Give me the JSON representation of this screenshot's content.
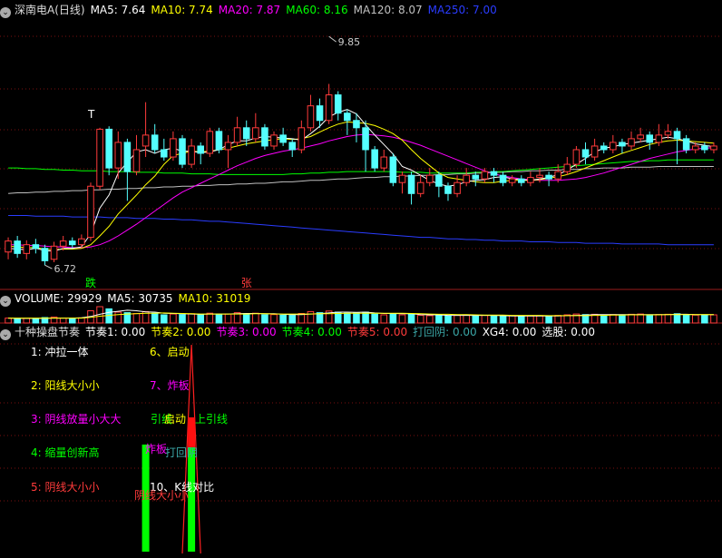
{
  "colors": {
    "up": "#ff3b3b",
    "down": "#54ffff",
    "ma5": "#ffffff",
    "ma10": "#ffff00",
    "ma20": "#ff00ff",
    "ma60": "#00ff00",
    "ma120": "#c0c0c0",
    "ma250": "#2a3cff",
    "grid": "#7a1010"
  },
  "price_panel": {
    "title": "深南电A(日线)",
    "ma": [
      {
        "label": "MA5: 7.64",
        "color": "#ffffff"
      },
      {
        "label": "MA10: 7.74",
        "color": "#ffff00"
      },
      {
        "label": "MA20: 7.87",
        "color": "#ff00ff"
      },
      {
        "label": "MA60: 8.16",
        "color": "#00ff00"
      },
      {
        "label": "MA120: 8.07",
        "color": "#c0c0c0"
      },
      {
        "label": "MA250: 7.00",
        "color": "#2a3cff"
      }
    ],
    "high_label": "9.85",
    "low_label": "6.72",
    "mark_t": "T",
    "mark_die": "跌",
    "mark_zhang": "张"
  },
  "volume_panel": {
    "labels": [
      {
        "label": "VOLUME: 29929",
        "color": "#ffffff"
      },
      {
        "label": "MA5: 30735",
        "color": "#ffffff"
      },
      {
        "label": "MA10: 31019",
        "color": "#ffff00"
      }
    ]
  },
  "indicator_panel": {
    "title": "十种操盘节奏",
    "labels": [
      {
        "label": "节奏1: 0.00",
        "color": "#ffffff"
      },
      {
        "label": "节奏2: 0.00",
        "color": "#ffff00"
      },
      {
        "label": "节奏3: 0.00",
        "color": "#ff00ff"
      },
      {
        "label": "节奏4: 0.00",
        "color": "#00ff00"
      },
      {
        "label": "节奏5: 0.00",
        "color": "#ff3b3b"
      },
      {
        "label": "打回阴: 0.00",
        "color": "#3aa6a6"
      },
      {
        "label": "XG4: 0.00",
        "color": "#ffffff"
      },
      {
        "label": "选股: 0.00",
        "color": "#ffffff"
      }
    ],
    "legend_left": [
      {
        "text": "1: 冲拉一体",
        "color": "#ffffff"
      },
      {
        "text": "2: 阳线大小小",
        "color": "#ffff00"
      },
      {
        "text": "3: 阴线放量小大大",
        "color": "#ff00ff"
      },
      {
        "text": "4: 缩量创新高",
        "color": "#00ff00"
      },
      {
        "text": "5: 阴线大小小",
        "color": "#ff3b3b"
      }
    ],
    "legend_right": [
      {
        "text": "6、启动",
        "color": "#ffff00"
      },
      {
        "text": "7、炸板",
        "color": "#ff00ff"
      },
      {
        "text": "上引线",
        "color": "#00ff00"
      },
      {
        "text": "打回阴",
        "color": "#3aa6a6"
      },
      {
        "text": "10、K线对比",
        "color": "#ffffff"
      }
    ],
    "overlay_texts": [
      {
        "text": "引线",
        "color": "#00ff00"
      },
      {
        "text": "启动",
        "color": "#ffff00"
      },
      {
        "text": "炸板",
        "color": "#ff00ff"
      },
      {
        "text": "阴线大小小",
        "color": "#ff3b3b"
      }
    ]
  },
  "chart_data": {
    "type": "candlestick",
    "ylim_price": [
      6.4,
      10.1
    ],
    "high": 9.85,
    "low": 6.72,
    "candles": [
      [
        6.9,
        7.05,
        6.8,
        7.1
      ],
      [
        7.05,
        6.88,
        6.82,
        7.12
      ],
      [
        6.88,
        7.0,
        6.8,
        7.06
      ],
      [
        7.0,
        6.95,
        6.88,
        7.08
      ],
      [
        6.95,
        6.78,
        6.72,
        7.0
      ],
      [
        6.8,
        6.98,
        6.76,
        7.04
      ],
      [
        6.98,
        7.05,
        6.92,
        7.12
      ],
      [
        7.05,
        7.0,
        6.95,
        7.1
      ],
      [
        7.0,
        7.08,
        6.96,
        7.14
      ],
      [
        7.1,
        7.8,
        7.05,
        7.85
      ],
      [
        7.8,
        8.58,
        7.75,
        8.6
      ],
      [
        8.58,
        8.05,
        7.95,
        8.62
      ],
      [
        8.05,
        8.4,
        7.9,
        8.55
      ],
      [
        8.4,
        8.0,
        7.6,
        8.45
      ],
      [
        8.0,
        8.3,
        7.95,
        8.5
      ],
      [
        8.35,
        8.5,
        8.2,
        8.95
      ],
      [
        8.5,
        8.3,
        8.25,
        8.65
      ],
      [
        8.3,
        8.2,
        8.15,
        8.45
      ],
      [
        8.2,
        8.45,
        8.15,
        8.55
      ],
      [
        8.45,
        8.1,
        8.05,
        8.5
      ],
      [
        8.1,
        8.35,
        8.05,
        8.45
      ],
      [
        8.35,
        8.25,
        8.1,
        8.4
      ],
      [
        8.25,
        8.55,
        8.2,
        8.6
      ],
      [
        8.55,
        8.3,
        8.25,
        8.6
      ],
      [
        8.3,
        8.4,
        8.05,
        8.5
      ],
      [
        8.4,
        8.6,
        8.35,
        8.75
      ],
      [
        8.6,
        8.45,
        8.35,
        8.7
      ],
      [
        8.45,
        8.6,
        8.4,
        8.8
      ],
      [
        8.6,
        8.35,
        8.3,
        8.65
      ],
      [
        8.35,
        8.5,
        8.3,
        8.55
      ],
      [
        8.5,
        8.4,
        8.35,
        8.6
      ],
      [
        8.4,
        8.3,
        8.2,
        8.45
      ],
      [
        8.3,
        8.6,
        8.25,
        8.7
      ],
      [
        8.6,
        8.9,
        8.55,
        9.05
      ],
      [
        8.9,
        8.7,
        8.6,
        9.0
      ],
      [
        8.7,
        9.05,
        8.65,
        9.2
      ],
      [
        9.05,
        8.8,
        8.7,
        9.1
      ],
      [
        8.8,
        8.7,
        8.5,
        8.85
      ],
      [
        8.7,
        8.6,
        8.4,
        8.8
      ],
      [
        8.6,
        8.3,
        8.0,
        8.7
      ],
      [
        8.3,
        8.05,
        8.0,
        8.35
      ],
      [
        8.05,
        8.2,
        8.0,
        8.3
      ],
      [
        8.2,
        7.85,
        7.8,
        8.25
      ],
      [
        7.85,
        7.95,
        7.7,
        8.0
      ],
      [
        7.95,
        7.7,
        7.55,
        8.0
      ],
      [
        7.7,
        7.85,
        7.65,
        7.95
      ],
      [
        7.85,
        7.95,
        7.8,
        8.05
      ],
      [
        7.95,
        7.8,
        7.65,
        8.0
      ],
      [
        7.8,
        7.7,
        7.6,
        7.85
      ],
      [
        7.7,
        7.85,
        7.65,
        7.95
      ],
      [
        7.85,
        7.95,
        7.8,
        8.05
      ],
      [
        7.95,
        7.9,
        7.8,
        8.0
      ],
      [
        7.9,
        8.0,
        7.85,
        8.05
      ],
      [
        8.0,
        7.95,
        7.85,
        8.05
      ],
      [
        7.95,
        7.85,
        7.8,
        8.0
      ],
      [
        7.85,
        7.9,
        7.8,
        7.95
      ],
      [
        7.9,
        7.85,
        7.8,
        7.95
      ],
      [
        7.85,
        7.92,
        7.8,
        8.0
      ],
      [
        7.92,
        7.95,
        7.85,
        8.05
      ],
      [
        7.95,
        7.9,
        7.8,
        8.0
      ],
      [
        7.9,
        8.0,
        7.85,
        8.1
      ],
      [
        8.0,
        8.1,
        7.95,
        8.2
      ],
      [
        8.1,
        8.3,
        8.05,
        8.35
      ],
      [
        8.3,
        8.2,
        8.1,
        8.4
      ],
      [
        8.2,
        8.35,
        8.15,
        8.45
      ],
      [
        8.35,
        8.3,
        8.25,
        8.4
      ],
      [
        8.3,
        8.4,
        8.25,
        8.5
      ],
      [
        8.4,
        8.35,
        8.25,
        8.45
      ],
      [
        8.35,
        8.45,
        8.3,
        8.55
      ],
      [
        8.45,
        8.5,
        8.4,
        8.6
      ],
      [
        8.5,
        8.4,
        8.3,
        8.55
      ],
      [
        8.4,
        8.5,
        8.35,
        8.65
      ],
      [
        8.5,
        8.55,
        8.45,
        8.65
      ],
      [
        8.55,
        8.45,
        8.1,
        8.6
      ],
      [
        8.45,
        8.3,
        8.25,
        8.5
      ],
      [
        8.3,
        8.35,
        8.25,
        8.4
      ],
      [
        8.35,
        8.3,
        8.25,
        8.4
      ],
      [
        8.3,
        8.35,
        8.25,
        8.4
      ]
    ],
    "ma5": [
      6.95,
      6.94,
      6.93,
      6.95,
      6.92,
      6.91,
      6.95,
      6.95,
      6.97,
      7.15,
      7.5,
      7.68,
      7.98,
      8.13,
      8.27,
      8.3,
      8.25,
      8.3,
      8.32,
      8.28,
      8.28,
      8.26,
      8.27,
      8.3,
      8.37,
      8.42,
      8.42,
      8.46,
      8.48,
      8.47,
      8.46,
      8.45,
      8.43,
      8.52,
      8.62,
      8.75,
      8.81,
      8.85,
      8.79,
      8.64,
      8.5,
      8.37,
      8.24,
      8.07,
      8.02,
      7.95,
      7.88,
      7.83,
      7.8,
      7.82,
      7.86,
      7.88,
      7.89,
      7.92,
      7.93,
      7.9,
      7.89,
      7.88,
      7.9,
      7.92,
      7.96,
      8.02,
      8.1,
      8.18,
      8.27,
      8.32,
      8.34,
      8.37,
      8.39,
      8.41,
      8.43,
      8.45,
      8.47,
      8.45,
      8.42,
      8.38,
      8.36,
      8.34
    ],
    "ma10": [
      6.98,
      6.97,
      6.96,
      6.96,
      6.94,
      6.93,
      6.94,
      6.94,
      6.95,
      7.0,
      7.12,
      7.25,
      7.42,
      7.55,
      7.68,
      7.82,
      7.94,
      8.1,
      8.22,
      8.25,
      8.28,
      8.27,
      8.28,
      8.3,
      8.32,
      8.35,
      8.38,
      8.4,
      8.42,
      8.44,
      8.45,
      8.44,
      8.45,
      8.48,
      8.54,
      8.6,
      8.65,
      8.68,
      8.67,
      8.66,
      8.63,
      8.58,
      8.52,
      8.43,
      8.3,
      8.18,
      8.08,
      7.98,
      7.92,
      7.9,
      7.88,
      7.86,
      7.85,
      7.85,
      7.87,
      7.88,
      7.88,
      7.88,
      7.89,
      7.91,
      7.93,
      7.96,
      8.0,
      8.05,
      8.1,
      8.15,
      8.2,
      8.25,
      8.29,
      8.33,
      8.37,
      8.4,
      8.42,
      8.43,
      8.42,
      8.41,
      8.4,
      8.39
    ],
    "ma20": [
      7.0,
      7.0,
      6.99,
      6.99,
      6.98,
      6.97,
      6.97,
      6.96,
      6.96,
      6.97,
      7.0,
      7.05,
      7.12,
      7.2,
      7.28,
      7.37,
      7.46,
      7.55,
      7.64,
      7.72,
      7.78,
      7.84,
      7.9,
      7.96,
      8.02,
      8.08,
      8.13,
      8.18,
      8.22,
      8.25,
      8.28,
      8.3,
      8.32,
      8.35,
      8.38,
      8.42,
      8.45,
      8.48,
      8.5,
      8.51,
      8.5,
      8.49,
      8.47,
      8.44,
      8.4,
      8.36,
      8.31,
      8.26,
      8.21,
      8.16,
      8.11,
      8.06,
      8.01,
      7.97,
      7.94,
      7.92,
      7.9,
      7.89,
      7.88,
      7.88,
      7.88,
      7.89,
      7.9,
      7.92,
      7.95,
      7.98,
      8.02,
      8.06,
      8.1,
      8.14,
      8.18,
      8.21,
      8.24,
      8.27,
      8.29,
      8.31,
      8.32,
      8.33
    ],
    "ma60": [
      8.05,
      8.05,
      8.04,
      8.04,
      8.03,
      8.03,
      8.02,
      8.02,
      8.01,
      8.01,
      8.01,
      8.0,
      8.0,
      8.0,
      7.99,
      7.99,
      7.99,
      7.98,
      7.98,
      7.98,
      7.97,
      7.97,
      7.97,
      7.96,
      7.96,
      7.96,
      7.96,
      7.96,
      7.96,
      7.96,
      7.96,
      7.97,
      7.97,
      7.98,
      7.98,
      7.99,
      7.99,
      8.0,
      8.0,
      8.0,
      8.0,
      8.0,
      8.0,
      7.99,
      7.99,
      7.99,
      7.98,
      7.98,
      7.98,
      7.98,
      7.98,
      7.99,
      7.99,
      8.0,
      8.0,
      8.01,
      8.02,
      8.03,
      8.04,
      8.05,
      8.06,
      8.07,
      8.08,
      8.09,
      8.1,
      8.11,
      8.12,
      8.13,
      8.14,
      8.14,
      8.15,
      8.15,
      8.16,
      8.16,
      8.16,
      8.16,
      8.16,
      8.16
    ],
    "ma120": [
      7.7,
      7.71,
      7.71,
      7.72,
      7.72,
      7.73,
      7.73,
      7.74,
      7.74,
      7.75,
      7.75,
      7.76,
      7.76,
      7.77,
      7.77,
      7.78,
      7.78,
      7.79,
      7.79,
      7.8,
      7.8,
      7.81,
      7.81,
      7.82,
      7.82,
      7.83,
      7.83,
      7.84,
      7.84,
      7.85,
      7.86,
      7.86,
      7.87,
      7.88,
      7.88,
      7.89,
      7.9,
      7.9,
      7.91,
      7.92,
      7.92,
      7.93,
      7.93,
      7.94,
      7.94,
      7.95,
      7.95,
      7.96,
      7.96,
      7.97,
      7.97,
      7.98,
      7.98,
      7.99,
      7.99,
      8.0,
      8.0,
      8.01,
      8.01,
      8.02,
      8.02,
      8.03,
      8.03,
      8.04,
      8.04,
      8.05,
      8.05,
      8.05,
      8.06,
      8.06,
      8.06,
      8.07,
      8.07,
      8.07,
      8.07,
      8.07,
      8.07,
      8.07
    ],
    "ma250": [
      7.4,
      7.4,
      7.4,
      7.39,
      7.39,
      7.39,
      7.39,
      7.38,
      7.38,
      7.38,
      7.38,
      7.37,
      7.37,
      7.37,
      7.36,
      7.36,
      7.36,
      7.35,
      7.35,
      7.34,
      7.34,
      7.33,
      7.32,
      7.32,
      7.31,
      7.3,
      7.29,
      7.28,
      7.27,
      7.26,
      7.25,
      7.24,
      7.23,
      7.22,
      7.21,
      7.2,
      7.19,
      7.18,
      7.17,
      7.16,
      7.15,
      7.14,
      7.13,
      7.12,
      7.11,
      7.1,
      7.1,
      7.09,
      7.08,
      7.08,
      7.07,
      7.07,
      7.06,
      7.06,
      7.05,
      7.05,
      7.05,
      7.04,
      7.04,
      7.04,
      7.03,
      7.03,
      7.03,
      7.02,
      7.02,
      7.02,
      7.02,
      7.01,
      7.01,
      7.01,
      7.01,
      7.01,
      7.0,
      7.0,
      7.0,
      7.0,
      7.0,
      7.0
    ],
    "volume": [
      18,
      16,
      17,
      15,
      20,
      22,
      18,
      17,
      19,
      45,
      60,
      52,
      40,
      38,
      35,
      42,
      36,
      30,
      33,
      31,
      34,
      30,
      36,
      32,
      33,
      38,
      34,
      36,
      30,
      31,
      29,
      28,
      35,
      42,
      38,
      44,
      40,
      36,
      38,
      40,
      33,
      30,
      35,
      30,
      32,
      28,
      27,
      29,
      26,
      28,
      30,
      27,
      28,
      26,
      25,
      27,
      24,
      26,
      27,
      25,
      28,
      30,
      33,
      31,
      32,
      30,
      31,
      30,
      32,
      33,
      30,
      31,
      32,
      34,
      30,
      29,
      30,
      30
    ],
    "vol_ma5": [
      18,
      17,
      17,
      17,
      17,
      18,
      18,
      18,
      19,
      24,
      32,
      39,
      43,
      47,
      45,
      41,
      40,
      36,
      35,
      34,
      33,
      32,
      33,
      33,
      33,
      34,
      35,
      35,
      34,
      34,
      32,
      31,
      31,
      33,
      34,
      37,
      40,
      40,
      39,
      40,
      37,
      35,
      35,
      34,
      34,
      31,
      30,
      30,
      28,
      28,
      28,
      28,
      28,
      28,
      27,
      26,
      26,
      26,
      26,
      26,
      26,
      27,
      28,
      29,
      31,
      31,
      31,
      31,
      31,
      31,
      31,
      31,
      31,
      32,
      32,
      31,
      31,
      31
    ],
    "vol_ma10": [
      18,
      18,
      18,
      18,
      18,
      18,
      18,
      18,
      18,
      21,
      25,
      28,
      31,
      33,
      34,
      36,
      36,
      37,
      36,
      35,
      34,
      33,
      33,
      33,
      33,
      33,
      33,
      34,
      34,
      33,
      33,
      33,
      33,
      33,
      34,
      34,
      35,
      36,
      36,
      36,
      36,
      36,
      36,
      36,
      35,
      34,
      33,
      32,
      32,
      31,
      31,
      30,
      29,
      29,
      29,
      28,
      28,
      28,
      28,
      27,
      27,
      27,
      27,
      27,
      28,
      28,
      29,
      29,
      30,
      30,
      30,
      30,
      31,
      31,
      31,
      31,
      31,
      31
    ],
    "indicator": {
      "red_spike": [
        24,
        27
      ],
      "red_bar": [
        27,
        28
      ],
      "green_bars": [
        25,
        36
      ]
    }
  }
}
